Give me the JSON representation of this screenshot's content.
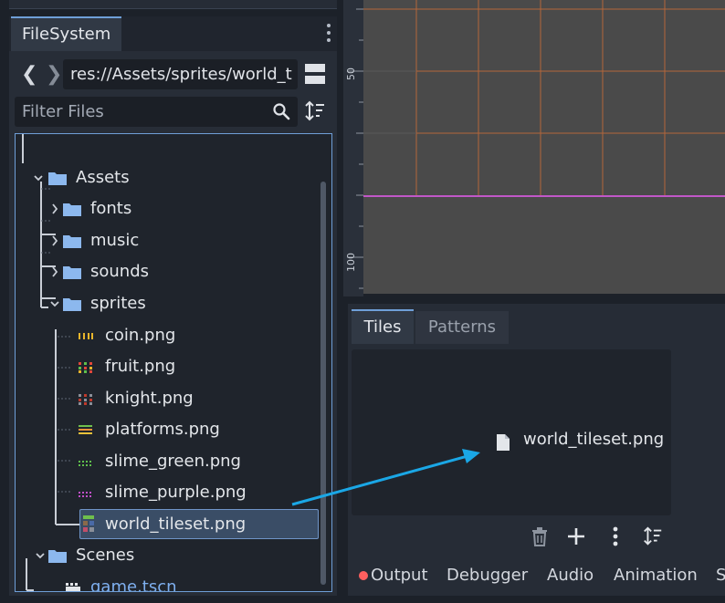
{
  "filesystem": {
    "tab_label": "FileSystem",
    "path": "res://Assets/sprites/world_t",
    "filter_placeholder": "Filter Files",
    "tree": {
      "assets": "Assets",
      "fonts": "fonts",
      "music": "music",
      "sounds": "sounds",
      "sprites": "sprites",
      "coin": "coin.png",
      "fruit": "fruit.png",
      "knight": "knight.png",
      "platforms": "platforms.png",
      "slime_green": "slime_green.png",
      "slime_purple": "slime_purple.png",
      "world_tileset": "world_tileset.png",
      "scenes": "Scenes",
      "game": "game.tscn"
    }
  },
  "viewport": {
    "ruler_labels": [
      "50",
      "100"
    ]
  },
  "tiles_panel": {
    "tab_tiles": "Tiles",
    "tab_patterns": "Patterns",
    "dropped_file": "world_tileset.png"
  },
  "bottom_bar": {
    "output": "Output",
    "debugger": "Debugger",
    "audio": "Audio",
    "animation": "Animation",
    "truncated": "S"
  },
  "colors": {
    "accent": "#6f9fd8",
    "folder": "#8cb8ee",
    "scene_link": "#7fb0f0",
    "drag_arrow": "#1aa7e6",
    "grid_line": "#b4663a",
    "axis_line": "#c257c8",
    "error_dot": "#ff5f5f"
  }
}
